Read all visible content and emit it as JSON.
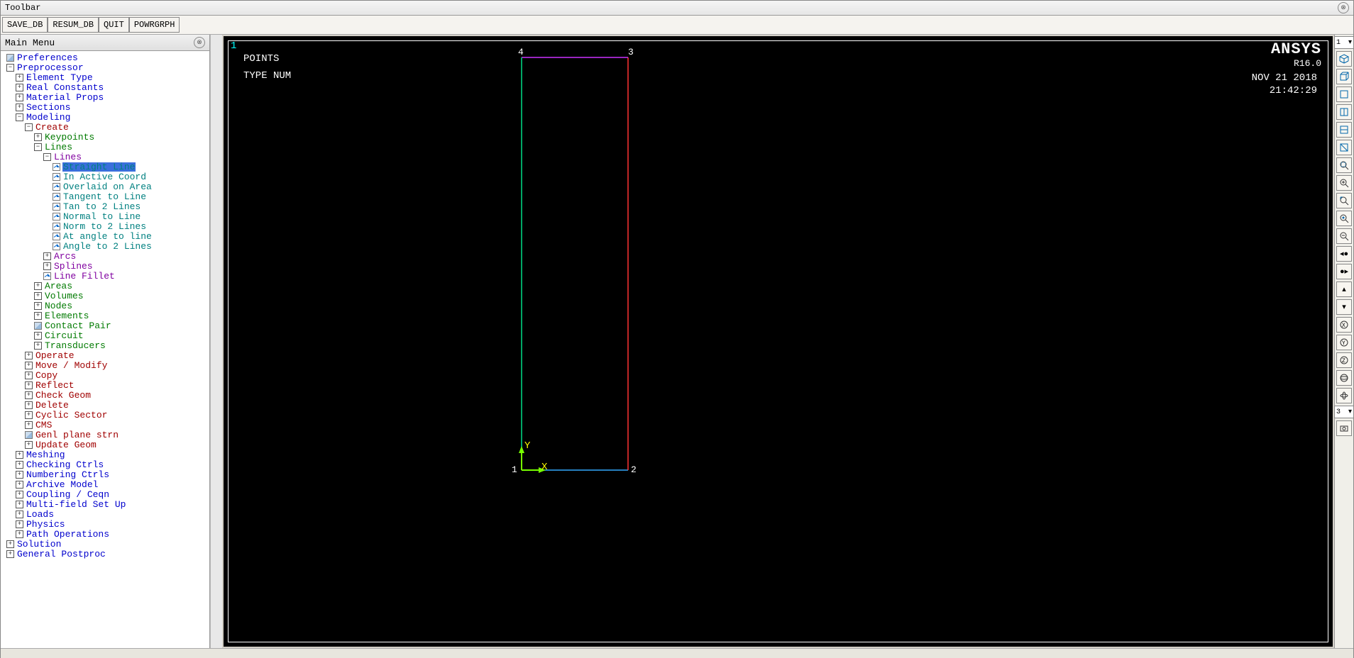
{
  "title": "Toolbar",
  "toolbar": {
    "save_db": "SAVE_DB",
    "resum_db": "RESUM_DB",
    "quit": "QUIT",
    "powrgrph": "POWRGRPH"
  },
  "main_menu": {
    "title": "Main Menu",
    "items": [
      {
        "depth": 0,
        "icon": "page",
        "label": "Preferences",
        "cls": "c-blue"
      },
      {
        "depth": 0,
        "icon": "minus",
        "label": "Preprocessor",
        "cls": "c-blue"
      },
      {
        "depth": 1,
        "icon": "plus",
        "label": "Element Type",
        "cls": "c-blue"
      },
      {
        "depth": 1,
        "icon": "plus",
        "label": "Real Constants",
        "cls": "c-blue"
      },
      {
        "depth": 1,
        "icon": "plus",
        "label": "Material Props",
        "cls": "c-blue"
      },
      {
        "depth": 1,
        "icon": "plus",
        "label": "Sections",
        "cls": "c-blue"
      },
      {
        "depth": 1,
        "icon": "minus",
        "label": "Modeling",
        "cls": "c-blue"
      },
      {
        "depth": 2,
        "icon": "minus",
        "label": "Create",
        "cls": "c-red"
      },
      {
        "depth": 3,
        "icon": "plus",
        "label": "Keypoints",
        "cls": "c-green"
      },
      {
        "depth": 3,
        "icon": "minus",
        "label": "Lines",
        "cls": "c-green"
      },
      {
        "depth": 4,
        "icon": "minus",
        "label": "Lines",
        "cls": "c-purple"
      },
      {
        "depth": 5,
        "icon": "arrow",
        "label": "Straight Line",
        "cls": "c-teal",
        "selected": true
      },
      {
        "depth": 5,
        "icon": "arrow",
        "label": "In Active Coord",
        "cls": "c-teal"
      },
      {
        "depth": 5,
        "icon": "arrow",
        "label": "Overlaid on Area",
        "cls": "c-teal"
      },
      {
        "depth": 5,
        "icon": "arrow",
        "label": "Tangent to Line",
        "cls": "c-teal"
      },
      {
        "depth": 5,
        "icon": "arrow",
        "label": "Tan to 2 Lines",
        "cls": "c-teal"
      },
      {
        "depth": 5,
        "icon": "arrow",
        "label": "Normal to Line",
        "cls": "c-teal"
      },
      {
        "depth": 5,
        "icon": "arrow",
        "label": "Norm to 2 Lines",
        "cls": "c-teal"
      },
      {
        "depth": 5,
        "icon": "arrow",
        "label": "At angle to line",
        "cls": "c-teal"
      },
      {
        "depth": 5,
        "icon": "arrow",
        "label": "Angle to 2 Lines",
        "cls": "c-teal"
      },
      {
        "depth": 4,
        "icon": "plus",
        "label": "Arcs",
        "cls": "c-purple"
      },
      {
        "depth": 4,
        "icon": "plus",
        "label": "Splines",
        "cls": "c-purple"
      },
      {
        "depth": 4,
        "icon": "arrow",
        "label": "Line Fillet",
        "cls": "c-purple"
      },
      {
        "depth": 3,
        "icon": "plus",
        "label": "Areas",
        "cls": "c-green"
      },
      {
        "depth": 3,
        "icon": "plus",
        "label": "Volumes",
        "cls": "c-green"
      },
      {
        "depth": 3,
        "icon": "plus",
        "label": "Nodes",
        "cls": "c-green"
      },
      {
        "depth": 3,
        "icon": "plus",
        "label": "Elements",
        "cls": "c-green"
      },
      {
        "depth": 3,
        "icon": "page",
        "label": "Contact Pair",
        "cls": "c-green"
      },
      {
        "depth": 3,
        "icon": "plus",
        "label": "Circuit",
        "cls": "c-green"
      },
      {
        "depth": 3,
        "icon": "plus",
        "label": "Transducers",
        "cls": "c-green"
      },
      {
        "depth": 2,
        "icon": "plus",
        "label": "Operate",
        "cls": "c-red"
      },
      {
        "depth": 2,
        "icon": "plus",
        "label": "Move / Modify",
        "cls": "c-red"
      },
      {
        "depth": 2,
        "icon": "plus",
        "label": "Copy",
        "cls": "c-red"
      },
      {
        "depth": 2,
        "icon": "plus",
        "label": "Reflect",
        "cls": "c-red"
      },
      {
        "depth": 2,
        "icon": "plus",
        "label": "Check Geom",
        "cls": "c-red"
      },
      {
        "depth": 2,
        "icon": "plus",
        "label": "Delete",
        "cls": "c-red"
      },
      {
        "depth": 2,
        "icon": "plus",
        "label": "Cyclic Sector",
        "cls": "c-red"
      },
      {
        "depth": 2,
        "icon": "plus",
        "label": "CMS",
        "cls": "c-red"
      },
      {
        "depth": 2,
        "icon": "page",
        "label": "Genl plane strn",
        "cls": "c-red"
      },
      {
        "depth": 2,
        "icon": "plus",
        "label": "Update Geom",
        "cls": "c-red"
      },
      {
        "depth": 1,
        "icon": "plus",
        "label": "Meshing",
        "cls": "c-blue"
      },
      {
        "depth": 1,
        "icon": "plus",
        "label": "Checking Ctrls",
        "cls": "c-blue"
      },
      {
        "depth": 1,
        "icon": "plus",
        "label": "Numbering Ctrls",
        "cls": "c-blue"
      },
      {
        "depth": 1,
        "icon": "plus",
        "label": "Archive Model",
        "cls": "c-blue"
      },
      {
        "depth": 1,
        "icon": "plus",
        "label": "Coupling / Ceqn",
        "cls": "c-blue"
      },
      {
        "depth": 1,
        "icon": "plus",
        "label": "Multi-field Set Up",
        "cls": "c-blue"
      },
      {
        "depth": 1,
        "icon": "plus",
        "label": "Loads",
        "cls": "c-blue"
      },
      {
        "depth": 1,
        "icon": "plus",
        "label": "Physics",
        "cls": "c-blue"
      },
      {
        "depth": 1,
        "icon": "plus",
        "label": "Path Operations",
        "cls": "c-blue"
      },
      {
        "depth": 0,
        "icon": "plus",
        "label": "Solution",
        "cls": "c-blue"
      },
      {
        "depth": 0,
        "icon": "plus",
        "label": "General Postproc",
        "cls": "c-blue"
      }
    ]
  },
  "graphics": {
    "top_index": "1",
    "label1": "POINTS",
    "label2": "TYPE NUM",
    "brand": "ANSYS",
    "version": "R16.0",
    "date": "NOV 21 2018",
    "time": "21:42:29",
    "axis_y": "Y",
    "axis_x": "X",
    "pt1": "1",
    "pt2": "2",
    "pt3": "3",
    "pt4": "4"
  },
  "right_toolbar": {
    "top_sel": "1",
    "bot_sel": "3"
  }
}
